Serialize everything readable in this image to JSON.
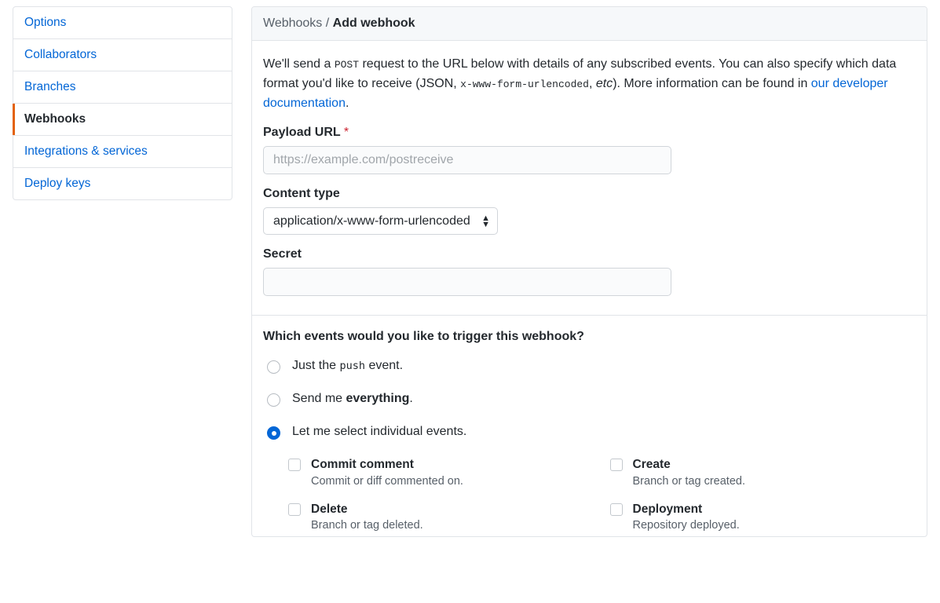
{
  "sidebar": {
    "items": [
      {
        "label": "Options",
        "active": false
      },
      {
        "label": "Collaborators",
        "active": false
      },
      {
        "label": "Branches",
        "active": false
      },
      {
        "label": "Webhooks",
        "active": true
      },
      {
        "label": "Integrations & services",
        "active": false
      },
      {
        "label": "Deploy keys",
        "active": false
      }
    ]
  },
  "breadcrumb": {
    "root": "Webhooks",
    "sep": "/",
    "leaf": "Add webhook"
  },
  "intro": {
    "text_1": "We'll send a ",
    "code_1": "POST",
    "text_2": " request to the URL below with details of any subscribed events. You can also specify which data format you'd like to receive (JSON, ",
    "code_2": "x-www-form-urlencoded",
    "text_3": ", ",
    "em_1": "etc",
    "text_4": "). More information can be found in ",
    "link_text": "our developer documentation",
    "text_5": "."
  },
  "form": {
    "payload_url": {
      "label": "Payload URL",
      "required_mark": "*",
      "placeholder": "https://example.com/postreceive",
      "value": ""
    },
    "content_type": {
      "label": "Content type",
      "selected": "application/x-www-form-urlencoded"
    },
    "secret": {
      "label": "Secret",
      "value": ""
    }
  },
  "events": {
    "heading": "Which events would you like to trigger this webhook?",
    "options": {
      "just_push": {
        "pre": "Just the ",
        "code": "push",
        "post": " event.",
        "selected": false
      },
      "everything": {
        "pre": "Send me ",
        "bold": "everything",
        "post": ".",
        "selected": false
      },
      "individual": {
        "text": "Let me select individual events.",
        "selected": true
      }
    },
    "individual_events": [
      {
        "title": "Commit comment",
        "desc": "Commit or diff commented on."
      },
      {
        "title": "Create",
        "desc": "Branch or tag created."
      },
      {
        "title": "Delete",
        "desc": "Branch or tag deleted."
      },
      {
        "title": "Deployment",
        "desc": "Repository deployed."
      }
    ]
  }
}
